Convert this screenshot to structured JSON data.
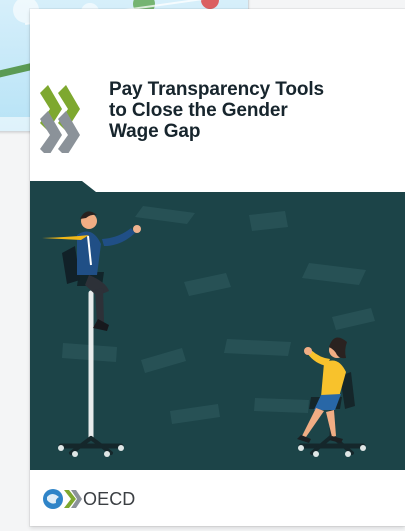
{
  "cover": {
    "title_lines": [
      "Pay Transparency Tools",
      "to Close the Gender",
      "Wage Gap"
    ],
    "publisher": "OECD"
  },
  "icons": {
    "series_logo": "double-chevron-icon",
    "publisher_logo": "globe-icon"
  },
  "colors": {
    "background": "#f4f5f6",
    "cover_background": "#ffffff",
    "title": "#17252d",
    "illustration_background": "#1c4448",
    "chevron_green": "#7ea82f",
    "chevron_gray": "#8b9299",
    "publisher_blue": "#2f84c8",
    "jacket": "#ffcc33"
  }
}
